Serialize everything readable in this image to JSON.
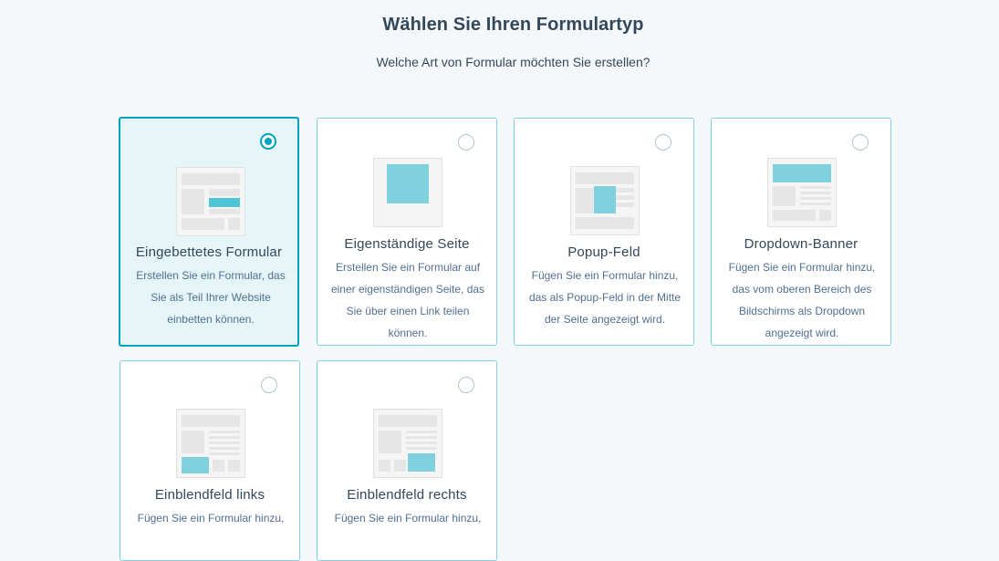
{
  "header": {
    "title": "Wählen Sie Ihren Formulartyp",
    "subtitle": "Welche Art von Formular möchten Sie erstellen?"
  },
  "colors": {
    "accent": "#00a4bd",
    "card_border": "#7fd1de",
    "illustration_fill": "#7fd1de",
    "illustration_bg": "#eaeaea"
  },
  "form_types": [
    {
      "id": "embedded",
      "title": "Eingebettetes Formular",
      "description": "Erstellen Sie ein Formular, das Sie als Teil Ihrer Website einbetten können.",
      "selected": true,
      "icon": "embedded-form-illustration"
    },
    {
      "id": "standalone",
      "title": "Eigenständige Seite",
      "description": "Erstellen Sie ein Formular auf einer eigenständigen Seite, das Sie über einen Link teilen können.",
      "selected": false,
      "icon": "standalone-page-illustration"
    },
    {
      "id": "popup",
      "title": "Popup-Feld",
      "description": "Fügen Sie ein Formular hinzu, das als Popup-Feld in der Mitte der Seite angezeigt wird.",
      "selected": false,
      "icon": "popup-box-illustration"
    },
    {
      "id": "dropdown",
      "title": "Dropdown-Banner",
      "description": "Fügen Sie ein Formular hinzu, das vom oberen Bereich des Bildschirms als Dropdown angezeigt wird.",
      "selected": false,
      "icon": "dropdown-banner-illustration"
    },
    {
      "id": "slidein-left",
      "title": "Einblendfeld links",
      "description": "Fügen Sie ein Formular hinzu,",
      "selected": false,
      "icon": "slide-in-left-illustration"
    },
    {
      "id": "slidein-right",
      "title": "Einblendfeld rechts",
      "description": "Fügen Sie ein Formular hinzu,",
      "selected": false,
      "icon": "slide-in-right-illustration"
    }
  ]
}
